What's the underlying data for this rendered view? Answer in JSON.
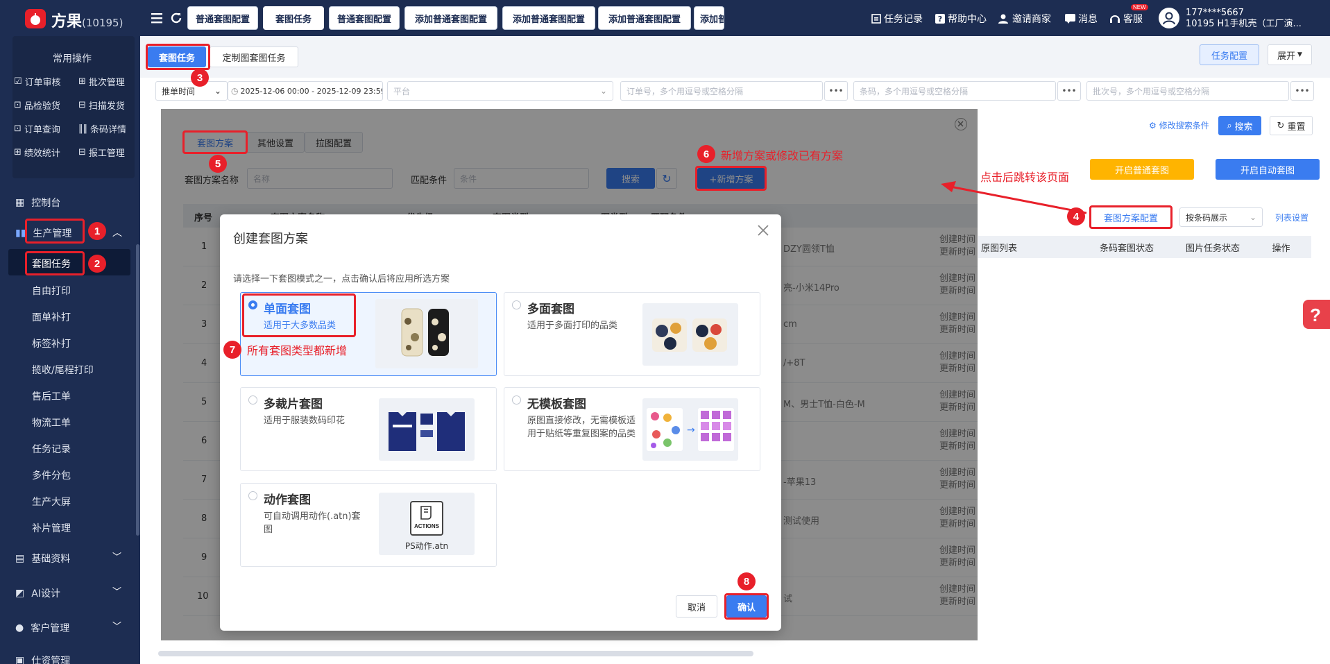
{
  "app": {
    "name": "方果",
    "count": "(10195)"
  },
  "top_tabs": [
    "普通套图配置",
    "套图任务",
    "普通套图配置",
    "添加普通套图配置",
    "添加普通套图配置",
    "添加普通套图配置",
    "添加普"
  ],
  "header_links": {
    "task_log": "任务记录",
    "help": "帮助中心",
    "invite": "邀请商家",
    "message": "消息",
    "service": "客服",
    "new_badge": "NEW",
    "user_phone": "177****5667",
    "user_shop": "10195 H1手机壳（工厂演..."
  },
  "sidebar": {
    "common_title": "常用操作",
    "common_ops": [
      "订单审核",
      "批次管理",
      "品检验货",
      "扫描发货",
      "订单查询",
      "条码详情",
      "绩效统计",
      "报工管理"
    ],
    "console": "控制台",
    "production": "生产管理",
    "sub_items": [
      "套图任务",
      "自由打印",
      "面单补打",
      "标签补打",
      "揽收/尾程打印",
      "售后工单",
      "物流工单",
      "任务记录",
      "多件分包",
      "生产大屏",
      "补片管理"
    ],
    "basic": "基础资料",
    "ai": "AI设计",
    "customer": "客户管理",
    "more": "仕资管理"
  },
  "page_tabs": [
    "套图任务",
    "定制图套图任务"
  ],
  "right_buttons": {
    "task_config": "任务配置",
    "expand": "展开"
  },
  "filters": {
    "time_type": "推单时间",
    "date_range": "2025-12-06 00:00 - 2025-12-09 23:59",
    "platform": "平台",
    "order_placeholder": "订单号，多个用逗号或空格分隔",
    "barcode_placeholder": "条码，多个用逗号或空格分隔",
    "batch_placeholder": "批次号，多个用逗号或空格分隔",
    "more": "•••"
  },
  "actions": {
    "edit_search": "修改搜索条件",
    "search": "搜索",
    "reset": "重置",
    "start_normal": "开启普通套图",
    "start_auto": "开启自动套图",
    "scheme_config": "套图方案配置",
    "display_mode": "按条码展示",
    "column_settings": "列表设置"
  },
  "right_table_headers": [
    "原图列表",
    "条码套图状态",
    "图片任务状态",
    "操作"
  ],
  "scheme_panel": {
    "tabs": [
      "套图方案",
      "其他设置",
      "拉图配置"
    ],
    "name_label": "套图方案名称",
    "name_placeholder": "名称",
    "cond_label": "匹配条件",
    "cond_placeholder": "条件",
    "search": "搜索",
    "add": "+新增方案",
    "headers": [
      "序号",
      "套图方案名称",
      "优先级",
      "套图类型",
      "图类型",
      "匹配条件"
    ],
    "rows": [
      {
        "no": "1",
        "cond": "DZY圆领T恤"
      },
      {
        "no": "2",
        "cond": "亮-小米14Pro"
      },
      {
        "no": "3",
        "cond": "cm"
      },
      {
        "no": "4",
        "cond": "/+8T"
      },
      {
        "no": "5",
        "cond": "M、男士T恤-白色-M"
      },
      {
        "no": "6",
        "cond": ""
      },
      {
        "no": "7",
        "cond": "-苹果13"
      },
      {
        "no": "8",
        "cond": "测试使用"
      },
      {
        "no": "9",
        "cond": ""
      },
      {
        "no": "10",
        "cond": "试"
      }
    ],
    "created": "创建时间",
    "updated": "更新时间"
  },
  "dialog": {
    "title": "创建套图方案",
    "hint": "请选择一下套图模式之一，点击确认后将应用所选方案",
    "modes": [
      {
        "title": "单面套图",
        "desc": "适用于大多数品类"
      },
      {
        "title": "多面套图",
        "desc": "适用于多面打印的品类"
      },
      {
        "title": "多裁片套图",
        "desc": "适用于服装数码印花"
      },
      {
        "title": "无模板套图",
        "desc": "原图直接修改，无需模板适用于贴纸等重复图案的品类"
      },
      {
        "title": "动作套图",
        "desc": "可自动调用动作(.atn)套图"
      }
    ],
    "actions_label": "ACTIONS",
    "ps_action": "PS动作.atn",
    "cancel": "取消",
    "confirm": "确认"
  },
  "annotations": {
    "n1": "1",
    "n2": "2",
    "n3": "3",
    "n4": "4",
    "n5": "5",
    "n6": "6",
    "n7": "7",
    "n8": "8",
    "text6": "新增方案或修改已有方案",
    "text7": "所有套图类型都新增",
    "jump": "点击后跳转该页面"
  },
  "colors": {
    "sidebar_bg": "#1d2d52",
    "accent_blue": "#3a7cf0",
    "orange": "#ffb400",
    "annotation_red": "#e8202a"
  }
}
